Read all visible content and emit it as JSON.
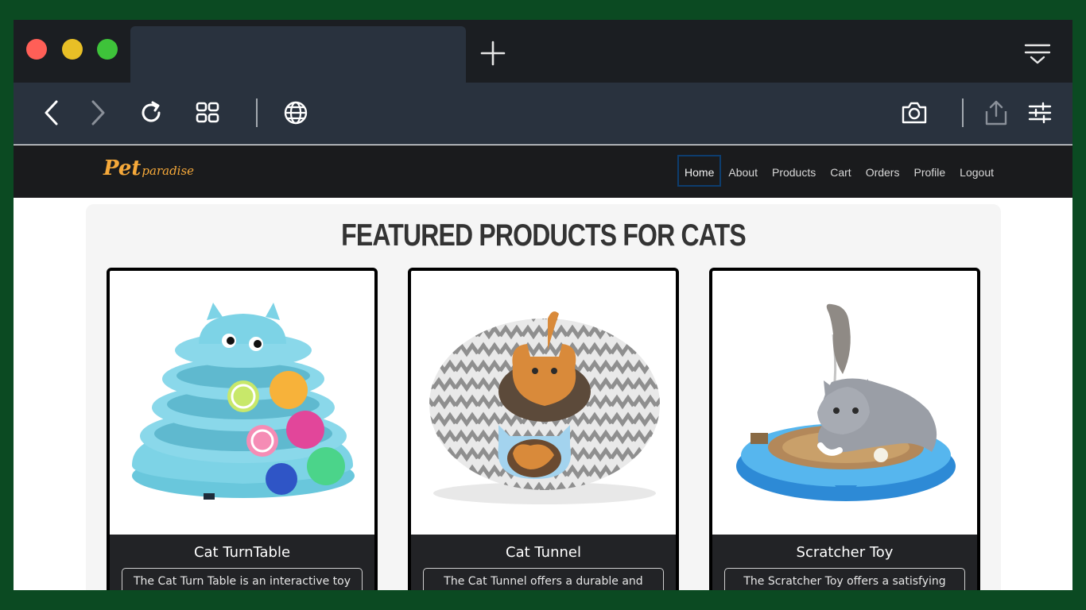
{
  "browser": {
    "active_tab_title": "",
    "icons": [
      "close-dot",
      "minimize-dot",
      "maximize-dot",
      "plus-icon",
      "tab-menu-icon",
      "back-icon",
      "forward-icon",
      "reload-icon",
      "grid-icon",
      "globe-icon",
      "camera-icon",
      "share-icon",
      "sliders-icon"
    ]
  },
  "site": {
    "logo_main": "Pet",
    "logo_sub": "paradise",
    "nav": [
      {
        "label": "Home",
        "active": true
      },
      {
        "label": "About"
      },
      {
        "label": "Products"
      },
      {
        "label": "Cart"
      },
      {
        "label": "Orders"
      },
      {
        "label": "Profile"
      },
      {
        "label": "Logout"
      }
    ],
    "colors": {
      "logo": "#f6a93a",
      "nav_bg": "#1a1b1d",
      "card_body": "#222326"
    }
  },
  "main": {
    "heading": "FEATURED PRODUCTS FOR CATS",
    "products": [
      {
        "name": "Cat TurnTable",
        "desc": "The Cat Turn Table is an interactive toy",
        "image": "cat-turntable-image"
      },
      {
        "name": "Cat Tunnel",
        "desc": "The Cat Tunnel offers a durable and",
        "image": "cat-tunnel-image"
      },
      {
        "name": "Scratcher Toy",
        "desc": "The Scratcher Toy offers a satisfying",
        "image": "scratcher-toy-image"
      }
    ]
  }
}
